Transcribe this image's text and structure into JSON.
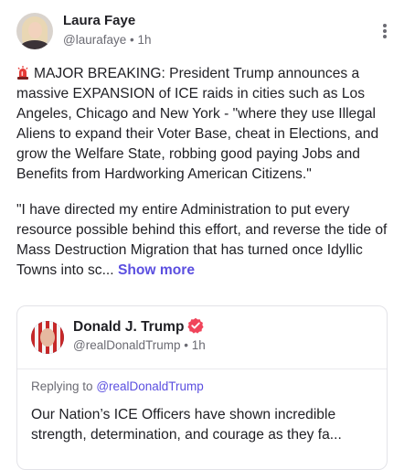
{
  "post": {
    "author": {
      "name": "Laura Faye",
      "handle": "@laurafaye",
      "separator": "•",
      "time": "1h"
    },
    "paragraph1": "MAJOR BREAKING: President Trump announces a massive EXPANSION of ICE raids in cities such as Los Angeles, Chicago and New York - \"where they use Illegal Aliens to expand their Voter Base, cheat in Elections, and grow the Welfare State, robbing good paying Jobs and Benefits from Hardworking American Citizens.\"",
    "paragraph2": "\"I have directed my entire Administration to put every resource possible behind this effort, and reverse the tide of Mass Destruction Migration that has turned once Idyllic Towns into sc...",
    "show_more_label": "Show more"
  },
  "quote": {
    "author": {
      "name": "Donald J. Trump",
      "handle": "@realDonaldTrump",
      "separator": "•",
      "time": "1h"
    },
    "replying_prefix": "Replying to",
    "replying_handle": "@realDonaldTrump",
    "body": "Our Nation’s ICE Officers have shown incredible strength, determination, and courage as they fa..."
  },
  "colors": {
    "accent": "#5b4fe0",
    "verified": "#f0445a",
    "siren": "#e53935"
  },
  "icons": {
    "siren": "police-light-icon",
    "verified": "verified-badge-icon",
    "more": "more-vertical-icon"
  }
}
